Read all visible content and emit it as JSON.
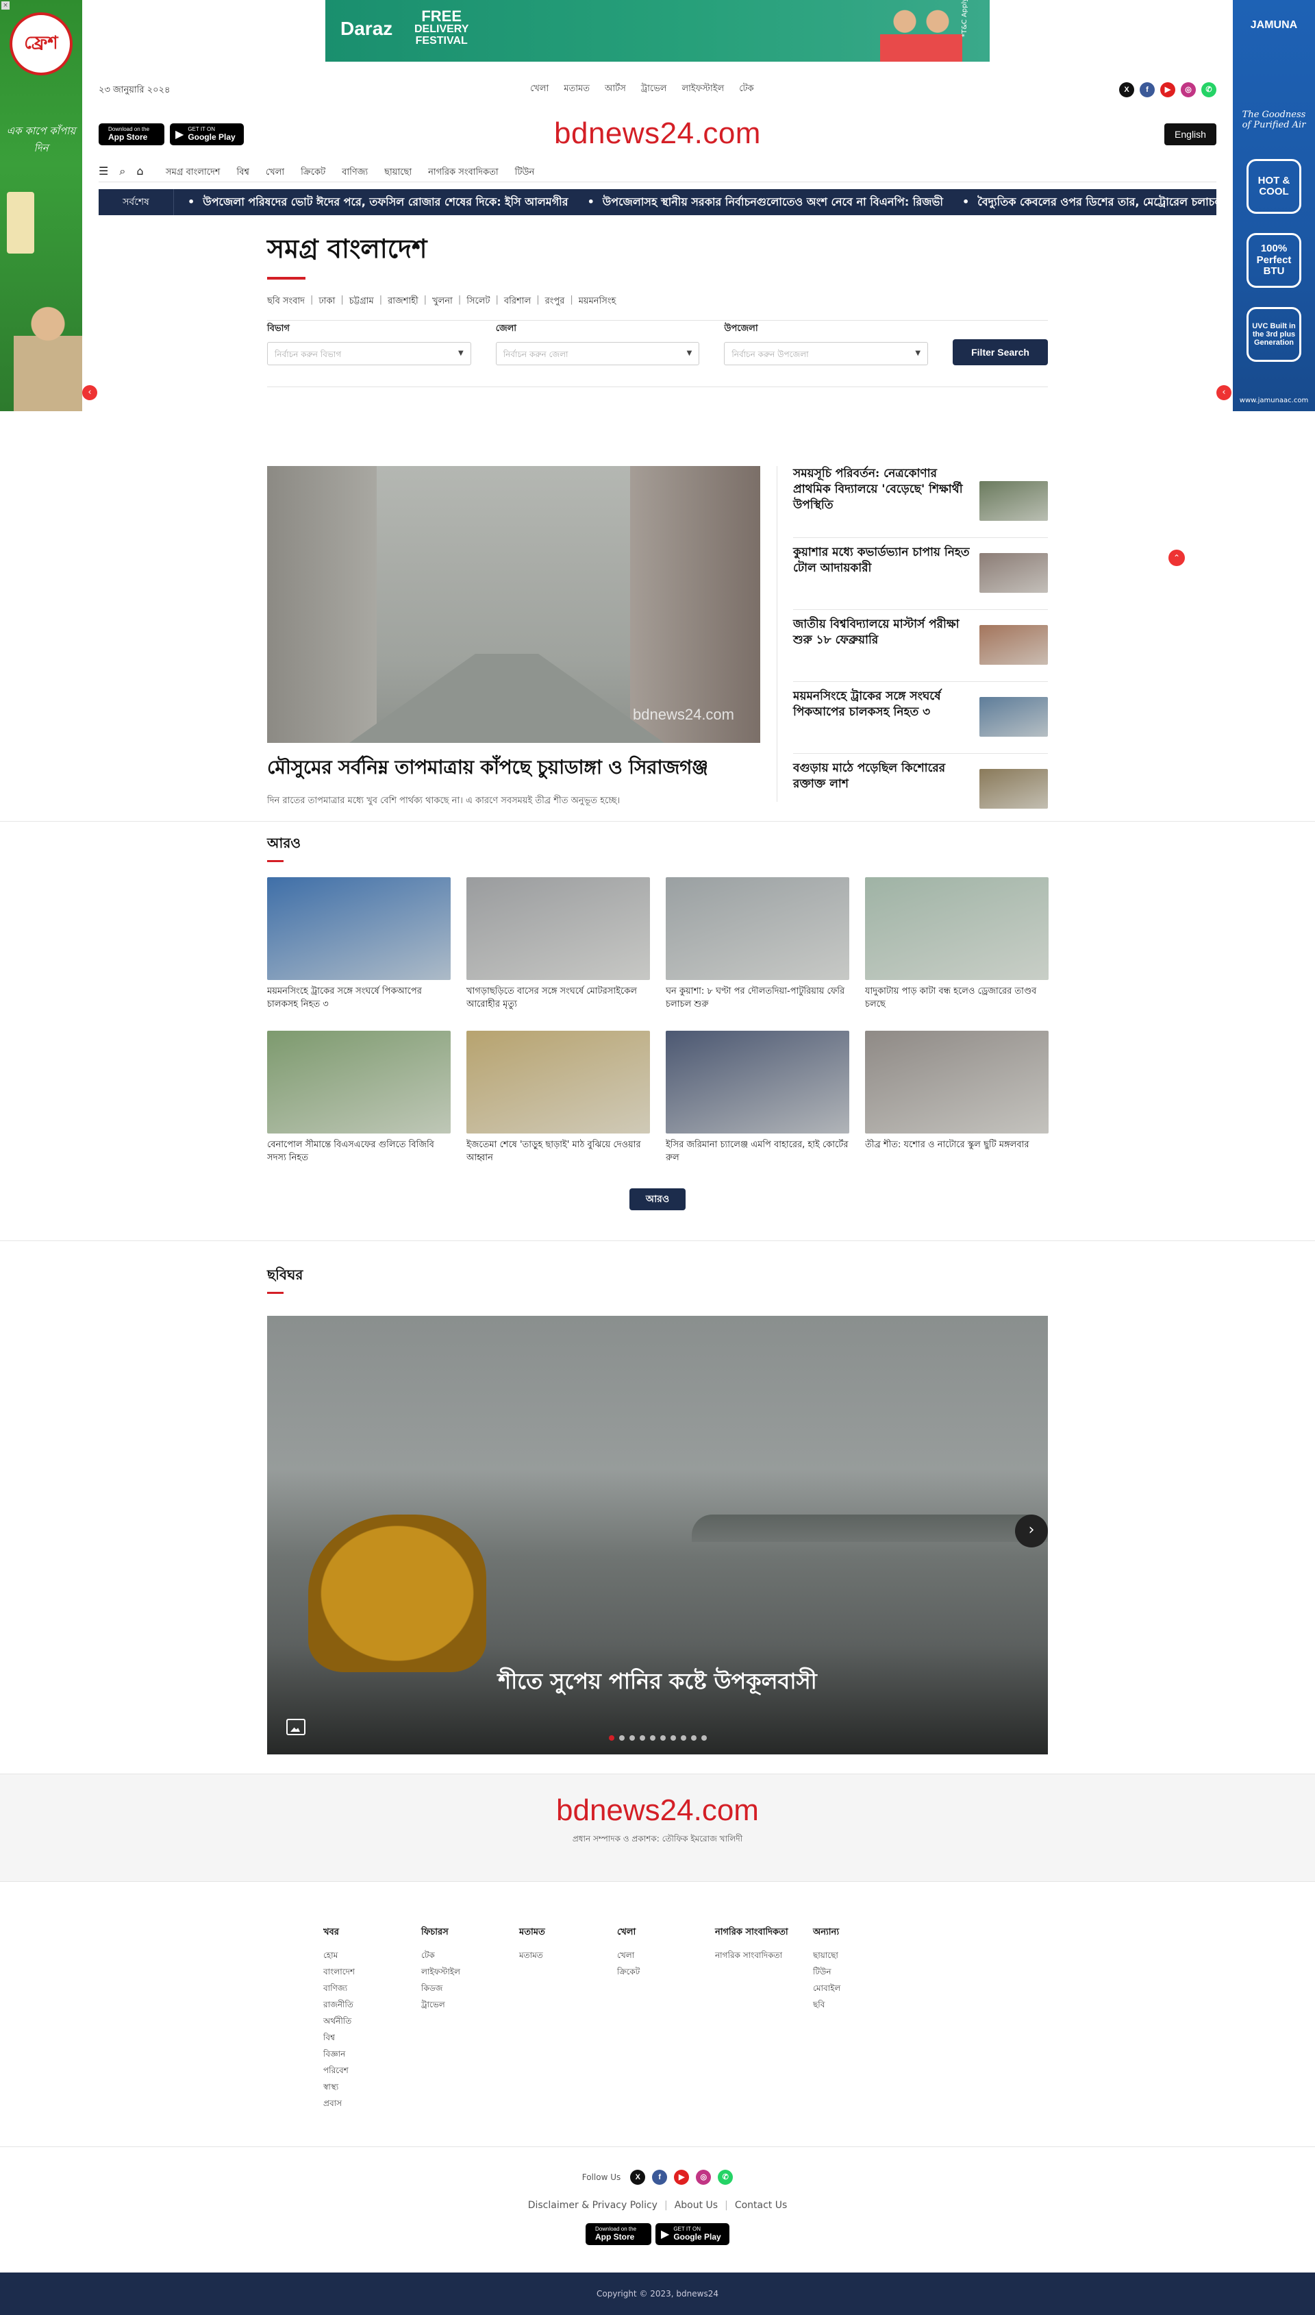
{
  "colors": {
    "brand_red": "#d41f26",
    "navy": "#1c2c4c",
    "ticker_bg": "#1c2c4c"
  },
  "ads": {
    "top_banner": {
      "brand": "Daraz",
      "line1": "FREE",
      "line2": "DELIVERY",
      "line3": "FESTIVAL",
      "note": "*T&C Apply"
    },
    "left": {
      "brand": "ফ্রেশ",
      "tagline": "এক কাপে কাঁপায় দিন"
    },
    "right": {
      "brand": "JAMUNA",
      "tagline": "The Goodness of Purified Air",
      "box1": "HOT & COOL",
      "box2": "100% Perfect BTU",
      "box3": "UVC Built in the 3rd plus Generation",
      "url": "www.jamunaac.com"
    }
  },
  "header": {
    "date": "২৩ জানুয়ারি ২০২৪",
    "util_links": [
      "খেলা",
      "মতামত",
      "আর্টস",
      "ট্রাভেল",
      "লাইফস্টাইল",
      "টেক"
    ],
    "social_icons": [
      "x-icon",
      "facebook-icon",
      "youtube-icon",
      "instagram-icon",
      "whatsapp-icon"
    ],
    "app_store": {
      "small": "Download on the",
      "big": "App Store"
    },
    "google_play": {
      "small": "GET IT ON",
      "big": "Google Play"
    },
    "logo": "bdnews24.com",
    "lang_button": "English",
    "nav_links": [
      "সমগ্র বাংলাদেশ",
      "বিশ্ব",
      "খেলা",
      "ক্রিকেট",
      "বাণিজ্য",
      "ছায়াছো",
      "নাগরিক সংবাদিকতা",
      "টিউন"
    ]
  },
  "ticker": {
    "label": "সর্বশেষ",
    "items": [
      "উপজেলা পরিষদের ভোট ঈদের পরে, তফসিল রোজার শেষের দিকে: ইসি আলমগীর",
      "উপজেলাসহ স্থানীয় সরকার নির্বাচনগুলোতেও অংশ নেবে না বিএনপি: রিজভী",
      "বৈদ্যুতিক কেবলের ওপর ডিশের তার, মেট্রোরেল চলাচল বিঘ্নিত"
    ]
  },
  "section": {
    "title": "সমগ্র বাংলাদেশ",
    "sub_links": [
      "ছবি সংবাদ",
      "ঢাকা",
      "চট্টগ্রাম",
      "রাজশাহী",
      "খুলনা",
      "সিলেট",
      "বরিশাল",
      "রংপুর",
      "ময়মনসিংহ"
    ]
  },
  "filters": {
    "division": {
      "label": "বিভাগ",
      "placeholder": "নির্বাচন করুন বিভাগ"
    },
    "district": {
      "label": "জেলা",
      "placeholder": "নির্বাচন করুন জেলা"
    },
    "upazila": {
      "label": "উপজেলা",
      "placeholder": "নির্বাচন করুন উপজেলা"
    },
    "button": "Filter Search"
  },
  "lead": {
    "watermark": "bdnews24.com",
    "title": "মৌসুমের সর্বনিম্ন তাপমাত্রায় কাঁপছে চুয়াডাঙ্গা ও সিরাজগঞ্জ",
    "summary": "দিন রাতের তাপমাত্রার মধ্যে খুব বেশি পার্থক্য থাকছে না। এ কারণে সবসময়ই তীব্র শীত অনুভূত হচ্ছে।"
  },
  "side_stories": [
    {
      "title": "সময়সূচি পরিবর্তন: নেত্রকোণার প্রাথমিক বিদ্যালয়ে 'বেড়েছে' শিক্ষার্থী উপস্থিতি",
      "color": "#6b7b5e"
    },
    {
      "title": "কুয়াশার মধ্যে কভার্ডভ্যান চাপায় নিহত টোল আদায়কারী",
      "color": "#8c7d76"
    },
    {
      "title": "জাতীয় বিশ্ববিদ্যালয়ে মাস্টার্স পরীক্ষা শুরু ১৮ ফেব্রুয়ারি",
      "color": "#a4755c"
    },
    {
      "title": "ময়মনসিংহে ট্রাকের সঙ্গে সংঘর্ষে পিকআপের চালকসহ নিহত ৩",
      "color": "#5e7d9a"
    },
    {
      "title": "বগুড়ায় মাঠে পড়েছিল কিশোরের রক্তাক্ত লাশ",
      "color": "#8a7a5a"
    }
  ],
  "more": {
    "title": "আরও",
    "button": "আরও",
    "cards": [
      {
        "title": "ময়মনসিংহে ট্রাকের সঙ্গে সংঘর্ষে পিকআপের চালকসহ নিহত ৩",
        "color": "#3f6fa8"
      },
      {
        "title": "খাগড়াছড়িতে বাসের সঙ্গে সংঘর্ষে মোটরসাইকেল আরোহীর মৃত্যু",
        "color": "#9a9c9e"
      },
      {
        "title": "ঘন কুয়াশা: ৮ ঘণ্টা পর দৌলতদিয়া-পাটুরিয়ায় ফেরি চলাচল শুরু",
        "color": "#9aa0a2"
      },
      {
        "title": "যাদুকাটায় পাড় কাটা বন্ধ হলেও ড্রেজারের তাণ্ডব চলছে",
        "color": "#9fb3a5"
      },
      {
        "title": "বেনাপোল সীমান্তে বিএসএফের গুলিতে বিজিবি সদস্য নিহত",
        "color": "#7d9a6e"
      },
      {
        "title": "ইজতেমা শেষে 'তাড়ুহ ছাড়াই' মাঠ বুঝিয়ে দেওয়ার আহ্বান",
        "color": "#b7a36f"
      },
      {
        "title": "ইসির জরিমানা চ্যালেঞ্জ এমপি বাহারের, হাই কোর্টের রুল",
        "color": "#4c5872"
      },
      {
        "title": "তীব্র শীত: যশোর ও নাটোরে স্কুল ছুটি মঙ্গলবার",
        "color": "#8f8a86"
      }
    ]
  },
  "photo_story": {
    "title": "ছবিঘর",
    "caption": "শীতে সুপেয় পানির কষ্টে উপকূলবাসী",
    "active_dot": 1,
    "total_dots": 10
  },
  "footer": {
    "logo": "bdnews24.com",
    "subline": "প্রধান সম্পাদক ও প্রকাশক: তৌফিক ইমরোজ খালিদী",
    "columns": [
      {
        "heading": "খবর",
        "links": [
          "হোম",
          "বাংলাদেশ",
          "বাণিজ্য",
          "রাজনীতি",
          "অর্থনীতি",
          "বিশ্ব",
          "বিজ্ঞান",
          "পরিবেশ",
          "স্বাস্থ্য",
          "প্রবাস"
        ]
      },
      {
        "heading": "ফিচারস",
        "links": [
          "টেক",
          "লাইফস্টাইল",
          "কিডজ",
          "ট্রাভেল"
        ]
      },
      {
        "heading": "মতামত",
        "links": [
          "মতামত"
        ]
      },
      {
        "heading": "খেলা",
        "links": [
          "খেলা",
          "ক্রিকেট"
        ]
      },
      {
        "heading": "নাগরিক সাংবাদিকতা",
        "links": [
          "নাগরিক সাংবাদিকতা"
        ]
      },
      {
        "heading": "অন্যান্য",
        "links": [
          "ছায়াছো",
          "টিউন",
          "মোবাইল",
          "ছবি"
        ]
      }
    ],
    "follow_label": "Follow Us",
    "legal_links": [
      "Disclaimer & Privacy Policy",
      "About Us",
      "Contact Us"
    ],
    "copyright": "Copyright © 2023, bdnews24"
  }
}
